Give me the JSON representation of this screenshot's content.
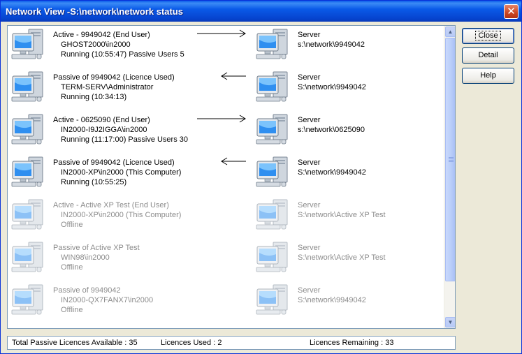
{
  "window": {
    "title": "Network View -S:\\network\\network status",
    "close_glyph": "✕"
  },
  "buttons": {
    "close": "Close",
    "detail": "Detail",
    "help": "Help"
  },
  "connections": [
    {
      "line1": "Active - 9949042 (End User)",
      "line2": "GHOST2000\\in2000",
      "line3": "Running (10:55:47) Passive Users 5",
      "server_label": "Server",
      "server_path": "s:\\network\\9949042",
      "arrow": "right",
      "online": true
    },
    {
      "line1": "Passive of 9949042 (Licence Used)",
      "line2": "TERM-SERV\\Administrator",
      "line3": "Running (10:34:13)",
      "server_label": "Server",
      "server_path": "S:\\network\\9949042",
      "arrow": "left",
      "online": true
    },
    {
      "line1": "Active - 0625090 (End User)",
      "line2": "IN2000-I9J2IGGA\\in2000",
      "line3": "Running (11:17:00) Passive Users 30",
      "server_label": "Server",
      "server_path": "s:\\network\\0625090",
      "arrow": "right",
      "online": true
    },
    {
      "line1": "Passive of 9949042 (Licence Used)",
      "line2": "IN2000-XP\\in2000 (This Computer)",
      "line3": "Running (10:55:25)",
      "server_label": "Server",
      "server_path": "S:\\network\\9949042",
      "arrow": "left",
      "online": true
    },
    {
      "line1": "Active - Active XP Test (End User)",
      "line2": "IN2000-XP\\in2000 (This Computer)",
      "line3": "Offline",
      "server_label": "Server",
      "server_path": "S:\\network\\Active XP Test",
      "arrow": "none",
      "online": false
    },
    {
      "line1": "Passive of Active XP Test",
      "line2": "WIN98\\in2000",
      "line3": "Offline",
      "server_label": "Server",
      "server_path": "S:\\network\\Active XP Test",
      "arrow": "none",
      "online": false
    },
    {
      "line1": "Passive of 9949042",
      "line2": "IN2000-QX7FANX7\\in2000",
      "line3": "Offline",
      "server_label": "Server",
      "server_path": "S:\\network\\9949042",
      "arrow": "none",
      "online": false
    }
  ],
  "status": {
    "total": "Total Passive Licences Available : 35",
    "used": "Licences Used : 2",
    "remaining": "Licences Remaining : 33"
  },
  "icons": {
    "computer": "computer-icon",
    "arrow_right": "arrow-right-icon",
    "arrow_left": "arrow-left-icon"
  },
  "colors": {
    "titlebar": "#0a5ae8",
    "offline_text": "#8c8c8c",
    "window_bg": "#ece9d8"
  }
}
